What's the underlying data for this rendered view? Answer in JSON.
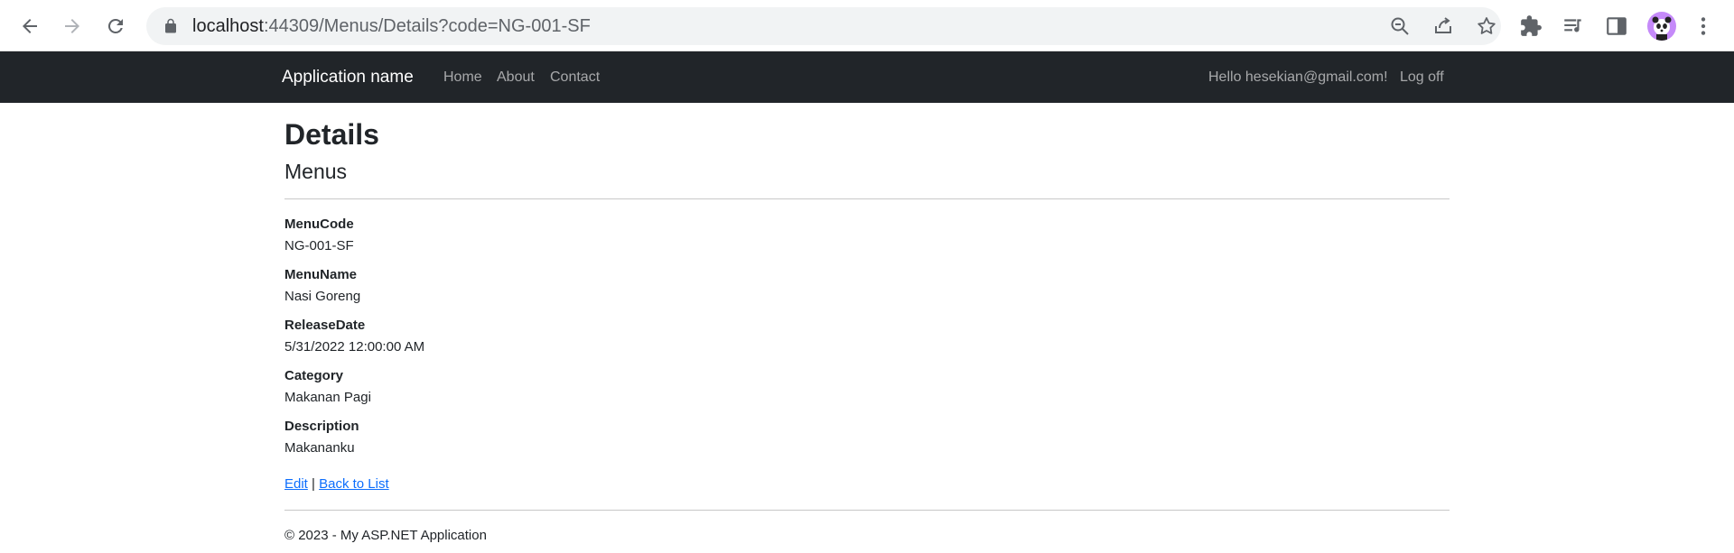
{
  "browser": {
    "url_host": "localhost",
    "url_rest": ":44309/Menus/Details?code=NG-001-SF"
  },
  "navbar": {
    "brand": "Application name",
    "links": [
      "Home",
      "About",
      "Contact"
    ],
    "greeting": "Hello hesekian@gmail.com!",
    "logoff": "Log off"
  },
  "page": {
    "title": "Details",
    "subtitle": "Menus"
  },
  "fields": [
    {
      "label": "MenuCode",
      "value": "NG-001-SF"
    },
    {
      "label": "MenuName",
      "value": "Nasi Goreng"
    },
    {
      "label": "ReleaseDate",
      "value": "5/31/2022 12:00:00 AM"
    },
    {
      "label": "Category",
      "value": "Makanan Pagi"
    },
    {
      "label": "Description",
      "value": "Makananku"
    }
  ],
  "actions": {
    "edit": "Edit",
    "separator": "|",
    "back": "Back to List"
  },
  "footer": {
    "text": "© 2023 - My ASP.NET Application"
  }
}
